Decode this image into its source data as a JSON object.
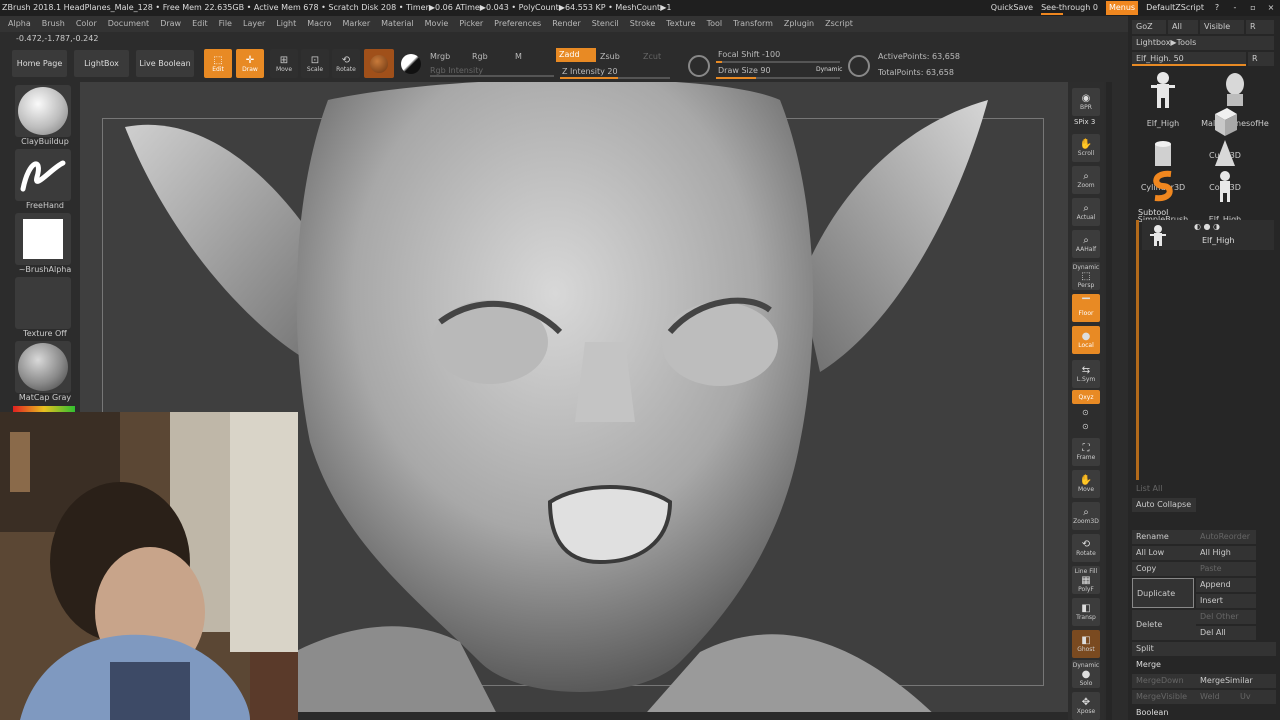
{
  "titlebar": {
    "info": "ZBrush 2018.1   HeadPlanes_Male_128   • Free Mem 22.635GB • Active Mem 678 • Scratch Disk 208 • Timer▶0.06 ATime▶0.043 • PolyCount▶64.553 KP • MeshCount▶1",
    "quicksave": "QuickSave",
    "see_through": "See-through  0",
    "menus": "Menus",
    "default_script": "DefaultZScript",
    "help": "?",
    "minimize": "‐",
    "restore": "▫",
    "close": "×"
  },
  "menubar": [
    "Alpha",
    "Brush",
    "Color",
    "Document",
    "Draw",
    "Edit",
    "File",
    "Layer",
    "Light",
    "Macro",
    "Marker",
    "Material",
    "Movie",
    "Picker",
    "Preferences",
    "Render",
    "Stencil",
    "Stroke",
    "Texture",
    "Tool",
    "Transform",
    "Zplugin",
    "Zscript"
  ],
  "coords": "-0.472,-1.787,-0.242",
  "toolbar": {
    "home_page": "Home Page",
    "lightbox": "LightBox",
    "live_boolean": "Live Boolean",
    "edit": "Edit",
    "draw": "Draw",
    "move": "Move",
    "scale": "Scale",
    "rotate": "Rotate",
    "mrgb": "Mrgb",
    "rgb": "Rgb",
    "m": "M",
    "rgb_intensity": "Rgb Intensity",
    "zadd": "Zadd",
    "zsub": "Zsub",
    "zcut": "Zcut",
    "z_intensity": "Z Intensity 20",
    "focal_shift": "Focal Shift -100",
    "draw_size": "Draw Size 90",
    "dynamic": "Dynamic",
    "active_points": "ActivePoints: 63,658",
    "total_points": "TotalPoints: 63,658"
  },
  "leftpanel": {
    "brush": "ClayBuildup",
    "stroke": "FreeHand",
    "alpha": "~BrushAlpha",
    "texture": "Texture Off",
    "material": "MatCap Gray"
  },
  "shelf": {
    "bpr": "BPR",
    "spix": "SPix 3",
    "scroll": "Scroll",
    "zoom": "Zoom",
    "actual": "Actual",
    "aahalf": "AAHalf",
    "dynamic": "Dynamic",
    "persp": "Persp",
    "floor": "Floor",
    "local": "Local",
    "lsym": "L.Sym",
    "xyz": "Qxyz",
    "frame": "Frame",
    "move": "Move",
    "zoom3d": "Zoom3D",
    "rotate": "Rotate",
    "line_fill": "Line Fill",
    "polyf": "PolyF",
    "transp": "Transp",
    "ghost": "Ghost",
    "dynamic2": "Dynamic",
    "solo": "Solo",
    "xpose": "Xpose"
  },
  "tray": {
    "goz": "GoZ",
    "all": "All",
    "visible": "Visible",
    "r": "R",
    "lightbox_tools": "Lightbox▶Tools",
    "elf_slider": "Elf_High. 50",
    "r2": "R",
    "tools": [
      "Elf_High",
      "Male_PlanesofHe",
      "Cube3D",
      "Cylinder3D",
      "Cone3D",
      "SimpleBrush",
      "Elf_High"
    ],
    "subtool_title": "Subtool",
    "subtool_item": "Elf_High",
    "list_all": "List All",
    "auto_collapse": "Auto Collapse",
    "rename": "Rename",
    "auto_reorder": "AutoReorder",
    "all_low": "All Low",
    "all_high": "All High",
    "copy": "Copy",
    "paste": "Paste",
    "duplicate": "Duplicate",
    "append": "Append",
    "insert": "Insert",
    "delete": "Delete",
    "del_other": "Del Other",
    "del_all": "Del All",
    "split": "Split",
    "merge": "Merge",
    "merge_down": "MergeDown",
    "merge_similar": "MergeSimilar",
    "merge_visible": "MergeVisible",
    "weld": "Weld",
    "uv": "Uv",
    "boolean": "Boolean"
  },
  "colors": {
    "accent": "#e88a24",
    "bg": "#2c2c2c"
  }
}
